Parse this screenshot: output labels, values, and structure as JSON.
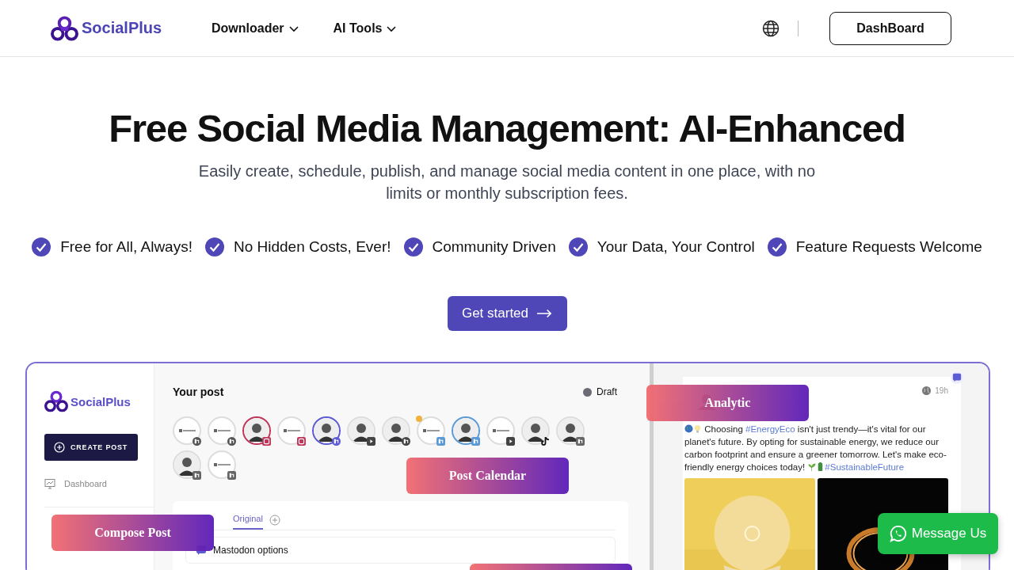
{
  "header": {
    "logo": "SocialPlus",
    "nav": [
      {
        "label": "Downloader"
      },
      {
        "label": "AI Tools"
      }
    ],
    "dashboard_button": "DashBoard"
  },
  "hero": {
    "title": "Free Social Media Management: AI-Enhanced",
    "subtitle": "Easily create, schedule, publish, and manage social media content in one place, with no limits or monthly subscription fees.",
    "features": [
      {
        "label": "Free for All, Always!"
      },
      {
        "label": "No Hidden Costs, Ever!"
      },
      {
        "label": "Community Driven"
      },
      {
        "label": "Your Data, Your Control"
      },
      {
        "label": "Feature Requests Welcome"
      }
    ],
    "cta": "Get started"
  },
  "preview": {
    "sidebar": {
      "logo": "SocialPlus",
      "create_button": "CREATE POST",
      "items": [
        {
          "label": "Dashboard"
        }
      ]
    },
    "post": {
      "title": "Your post",
      "status": {
        "label": "Draft",
        "color": "#6b6b76"
      },
      "accounts": [
        {
          "kind": "logo",
          "badge": {
            "kind": "facebook"
          },
          "selected": false,
          "alert": false
        },
        {
          "kind": "logo",
          "badge": {
            "kind": "facebook"
          },
          "selected": false,
          "alert": false
        },
        {
          "badge": {
            "kind": "instagram"
          },
          "selected": true,
          "alert": false
        },
        {
          "kind": "logo",
          "badge": {
            "kind": "instagram"
          },
          "selected": false,
          "alert": false
        },
        {
          "badge": {
            "kind": "mastodon"
          },
          "selected": true,
          "alert": false
        },
        {
          "badge": {
            "kind": "youtube"
          },
          "selected": false,
          "alert": false
        },
        {
          "badge": {
            "kind": "pinterest"
          },
          "selected": false,
          "alert": false
        },
        {
          "kind": "logo",
          "badge": {
            "kind": "twitter"
          },
          "selected": false,
          "alert": true
        },
        {
          "badge": {
            "kind": "twitter"
          },
          "selected": true,
          "alert": false
        },
        {
          "kind": "logo",
          "badge": {
            "kind": "youtube"
          },
          "selected": false,
          "alert": false
        },
        {
          "badge": {
            "kind": "tiktok"
          },
          "selected": false,
          "alert": false
        },
        {
          "badge": {
            "kind": "linkedin"
          },
          "selected": false,
          "alert": false
        },
        {
          "badge": {
            "kind": "linkedin"
          },
          "selected": false,
          "alert": false
        },
        {
          "kind": "logo",
          "badge": {
            "kind": "linkedin"
          },
          "selected": false,
          "alert": false
        }
      ],
      "tabs": [
        {
          "label": "Original",
          "selected": true
        }
      ],
      "options": [
        {
          "label": "Mastodon options"
        }
      ]
    },
    "preview_card": {
      "time": "19h",
      "text": [
        {
          "kind": "text",
          "text": "Choosing "
        },
        {
          "kind": "hashtag",
          "text": "#EnergyEco"
        },
        {
          "kind": "text",
          "text": " isn't just trendy—it's vital for our planet's future. By opting for sustainable energy, we reduce our carbon footprint and ensure a greener tomorrow. Let's make eco-friendly energy choices today! "
        },
        {
          "kind": "hashtag",
          "text": "#SustainableFuture"
        }
      ]
    },
    "banners": [
      {
        "label": "Compose Post"
      },
      {
        "label": "Post Calendar"
      },
      {
        "label": "Analytic"
      }
    ]
  },
  "chat_button": "Message Us"
}
